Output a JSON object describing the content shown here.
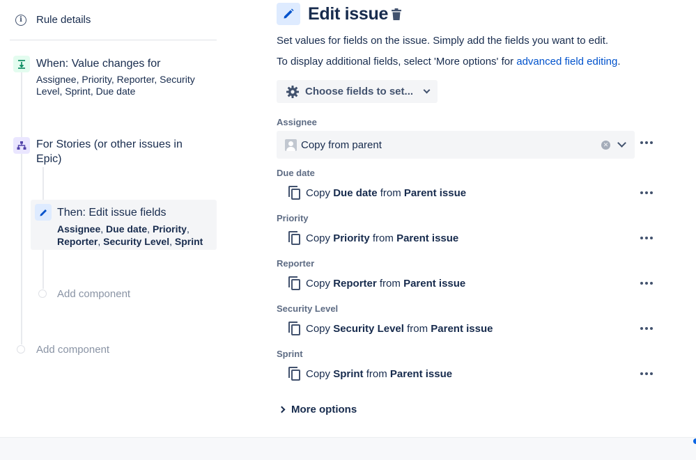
{
  "sidebar": {
    "rule_details": "Rule details",
    "trigger": {
      "title": "When: Value changes for",
      "fields": "Assignee, Priority, Reporter, Security Level, Sprint, Due date"
    },
    "branch": {
      "title": "For Stories (or other issues in Epic)"
    },
    "action": {
      "title": "Then: Edit issue fields",
      "fields": [
        "Assignee",
        "Due date",
        "Priority",
        "Reporter",
        "Security Level",
        "Sprint"
      ]
    },
    "add_component_inner": "Add component",
    "add_component_outer": "Add component"
  },
  "editor": {
    "title": "Edit issue",
    "description": "Set values for fields on the issue. Simply add the fields you want to edit.",
    "more_fields_prefix": "To display additional fields, select 'More options' for ",
    "more_fields_link": "advanced field editing",
    "more_fields_suffix": ".",
    "choose_fields_label": "Choose fields to set...",
    "assignee": {
      "label": "Assignee",
      "value": "Copy from parent"
    },
    "copy_word": "Copy",
    "from_word": "from",
    "fields": [
      {
        "label": "Due date",
        "field": "Due date",
        "source": "Parent issue"
      },
      {
        "label": "Priority",
        "field": "Priority",
        "source": "Parent issue"
      },
      {
        "label": "Reporter",
        "field": "Reporter",
        "source": "Parent issue"
      },
      {
        "label": "Security Level",
        "field": "Security Level",
        "source": "Parent issue"
      },
      {
        "label": "Sprint",
        "field": "Sprint",
        "source": "Parent issue"
      }
    ],
    "more_options": "More options"
  },
  "colors": {
    "text": "#172b4d",
    "link": "#0052cc",
    "subtle": "#5e6c84",
    "placeholder": "#8993a4",
    "trigger_bg": "#e3fcef",
    "branch_bg": "#eae6ff",
    "action_bg": "#deebff"
  },
  "icons": {
    "rule_details": "info-icon",
    "trigger": "trigger-icon",
    "branch": "branch-icon",
    "action": "pencil-icon",
    "delete": "trash-icon",
    "choose": "gear-icon",
    "copy": "copy-icon",
    "more": "more-icon"
  }
}
